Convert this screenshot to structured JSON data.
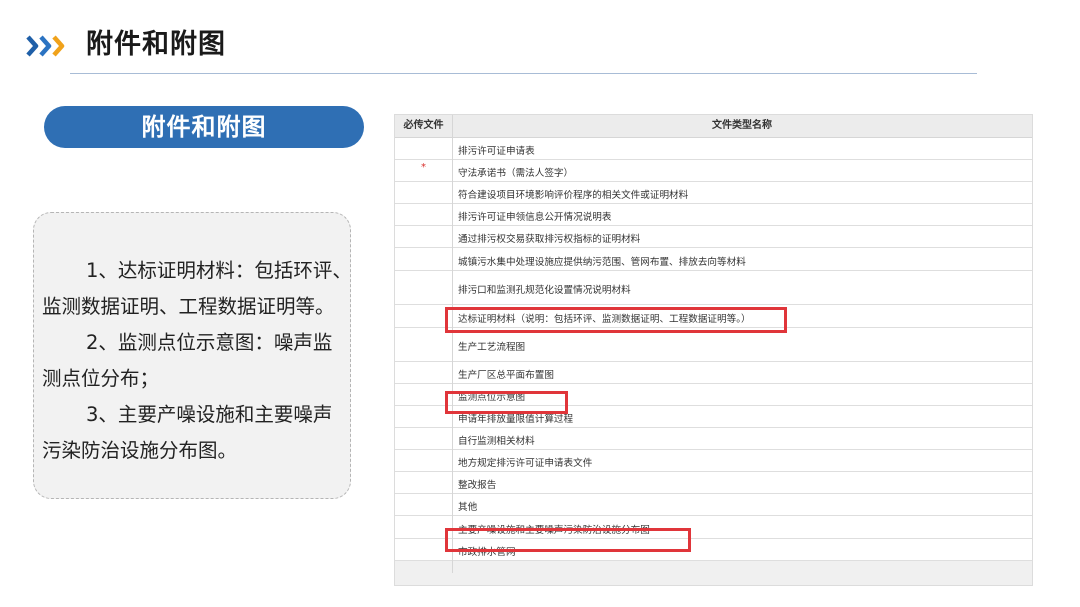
{
  "header": {
    "title": "附件和附图",
    "icon": "triple-chevron-right-icon"
  },
  "section": {
    "label": "附件和附图"
  },
  "description": {
    "p1_first": "1、达标证明材料：包括环评、",
    "p1_rest": "监测数据证明、工程数据证明等。",
    "p2_first": "2、监测点位示意图：噪声监",
    "p2_rest": "测点位分布；",
    "p3_first": "3、主要产噪设施和主要噪声",
    "p3_rest": "污染防治设施分布图。"
  },
  "table": {
    "columns": [
      "必传文件",
      "文件类型名称"
    ],
    "rows": [
      {
        "required": "",
        "name": "排污许可证申请表"
      },
      {
        "required": "*",
        "name": "守法承诺书（需法人签字）"
      },
      {
        "required": "",
        "name": "符合建设项目环境影响评价程序的相关文件或证明材料"
      },
      {
        "required": "",
        "name": "排污许可证申领信息公开情况说明表"
      },
      {
        "required": "",
        "name": "通过排污权交易获取排污权指标的证明材料"
      },
      {
        "required": "",
        "name": "城镇污水集中处理设施应提供纳污范围、管网布置、排放去向等材料"
      },
      {
        "required": "",
        "name": "排污口和监测孔规范化设置情况说明材料"
      },
      {
        "required": "",
        "name": "达标证明材料（说明：包括环评、监测数据证明、工程数据证明等。）"
      },
      {
        "required": "",
        "name": "生产工艺流程图"
      },
      {
        "required": "",
        "name": "生产厂区总平面布置图"
      },
      {
        "required": "",
        "name": "监测点位示意图"
      },
      {
        "required": "",
        "name": "申请年排放量限值计算过程"
      },
      {
        "required": "",
        "name": "自行监测相关材料"
      },
      {
        "required": "",
        "name": "地方规定排污许可证申请表文件"
      },
      {
        "required": "",
        "name": "整改报告"
      },
      {
        "required": "",
        "name": "其他"
      },
      {
        "required": "",
        "name": "主要产噪设施和主要噪声污染防治设施分布图"
      },
      {
        "required": "",
        "name": "市政排水管网"
      }
    ]
  },
  "colors": {
    "accent": "#2f6fb4",
    "highlight": "#e0353a",
    "chevron": "#1f5fa8"
  }
}
